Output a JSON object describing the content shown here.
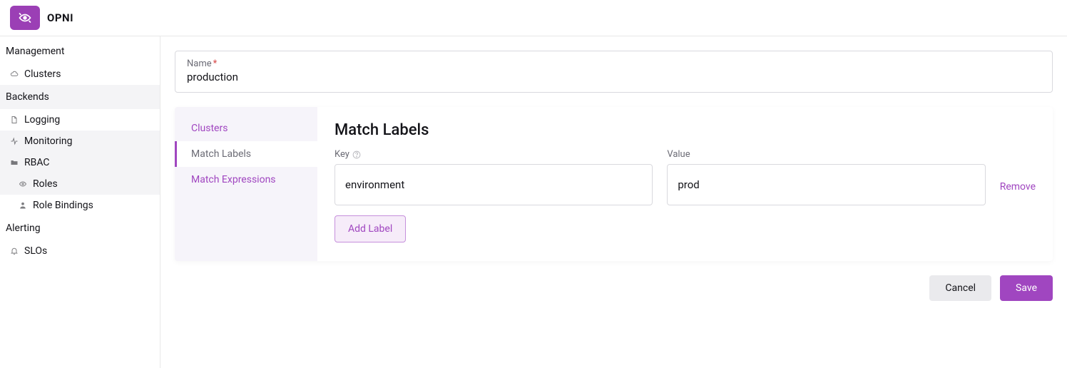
{
  "brand": "OPNI",
  "sidebar": {
    "groups": [
      {
        "label": "Management",
        "shaded": false,
        "items": [
          {
            "label": "Clusters",
            "icon": "cloud",
            "sub": false,
            "shaded": false
          }
        ]
      },
      {
        "label": "Backends",
        "shaded": true,
        "items": [
          {
            "label": "Logging",
            "icon": "file",
            "sub": false,
            "shaded": false
          },
          {
            "label": "Monitoring",
            "icon": "pulse",
            "sub": false,
            "shaded": true
          },
          {
            "label": "RBAC",
            "icon": "folder",
            "sub": false,
            "shaded": true
          },
          {
            "label": "Roles",
            "icon": "eye",
            "sub": true,
            "shaded": true
          },
          {
            "label": "Role Bindings",
            "icon": "user",
            "sub": true,
            "shaded": false
          }
        ]
      },
      {
        "label": "Alerting",
        "shaded": false,
        "items": [
          {
            "label": "SLOs",
            "icon": "bell",
            "sub": false,
            "shaded": false
          }
        ]
      }
    ]
  },
  "form": {
    "name_label": "Name",
    "name_value": "production",
    "tabs": [
      {
        "label": "Clusters",
        "active": false
      },
      {
        "label": "Match Labels",
        "active": true
      },
      {
        "label": "Match Expressions",
        "active": false
      }
    ],
    "match_labels": {
      "heading": "Match Labels",
      "key_label": "Key",
      "value_label": "Value",
      "rows": [
        {
          "key": "environment",
          "value": "prod"
        }
      ],
      "remove_label": "Remove",
      "add_label": "Add Label"
    },
    "cancel_label": "Cancel",
    "save_label": "Save"
  }
}
